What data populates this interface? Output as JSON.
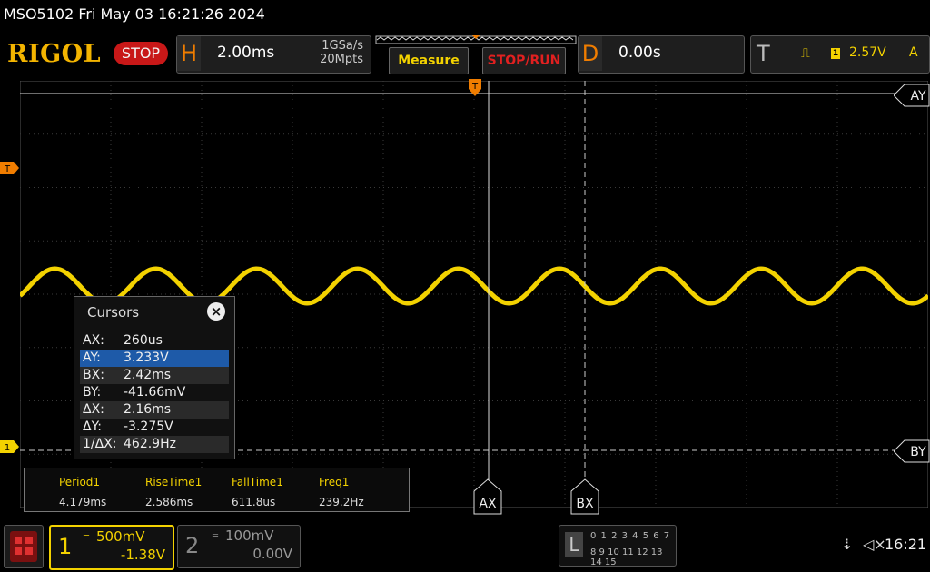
{
  "header": {
    "title": "MSO5102  Fri May 03 16:21:26 2024",
    "logo": "RIGOL",
    "run_state": "STOP",
    "h_letter": "H",
    "timebase": "2.00ms",
    "sample_rate": "1GSa/s",
    "memory_depth": "20Mpts",
    "measure_label": "Measure",
    "stoprun_label": "STOP/RUN",
    "d_letter": "D",
    "delay": "0.00s",
    "t_letter": "T",
    "trigger_channel": "1",
    "trigger_level": "2.57V",
    "trigger_mode": "A"
  },
  "markers": {
    "trigger_pos": "T",
    "trigger_level_marker": "T",
    "ch1_marker": "1",
    "ay": "AY",
    "by": "BY",
    "ax": "AX",
    "bx": "BX"
  },
  "cursors": {
    "title": "Cursors",
    "close": "×",
    "rows": [
      {
        "label": "AX:",
        "value": "260us"
      },
      {
        "label": "AY:",
        "value": "3.233V"
      },
      {
        "label": "BX:",
        "value": "2.42ms"
      },
      {
        "label": "BY:",
        "value": "-41.66mV"
      },
      {
        "label": "ΔX:",
        "value": "2.16ms"
      },
      {
        "label": "ΔY:",
        "value": "-3.275V"
      },
      {
        "label": "1/ΔX:",
        "value": "462.9Hz"
      }
    ]
  },
  "measurements": [
    {
      "name": "Period1",
      "value": "4.179ms"
    },
    {
      "name": "RiseTime1",
      "value": "2.586ms"
    },
    {
      "name": "FallTime1",
      "value": "611.8us"
    },
    {
      "name": "Freq1",
      "value": "239.2Hz"
    }
  ],
  "channels": {
    "ch1": {
      "num": "1",
      "scale": "500mV",
      "offset": "-1.38V"
    },
    "ch2": {
      "num": "2",
      "scale": "100mV",
      "offset": "0.00V"
    }
  },
  "la": {
    "letter": "L",
    "row1": "0 1 2 3  4 5 6 7",
    "row2": "8 9 10 11 12 13 14 15"
  },
  "status": {
    "time": "16:21"
  },
  "colors": {
    "ch1": "#f3d200",
    "trigger": "#f07d00",
    "brand": "#f3b400",
    "selected": "#1e5aa8"
  },
  "chart_data": {
    "type": "line",
    "series": [
      {
        "name": "",
        "shape": "sine",
        "periods_visible": 9,
        "color": "#f3d200"
      }
    ]
  }
}
